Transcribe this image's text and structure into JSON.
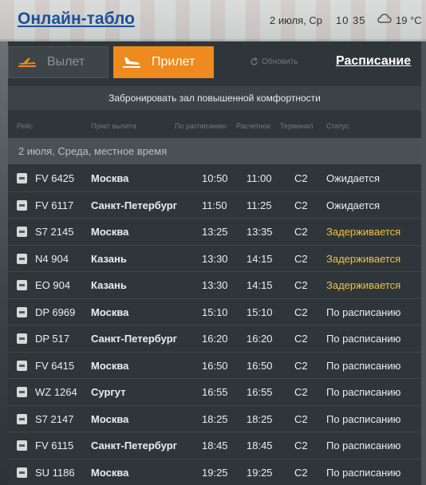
{
  "header": {
    "title": "Онлайн-табло",
    "date": "2 июля, Ср",
    "time": "10 35",
    "temperature": "19 °C",
    "weather_icon": "cloud-icon"
  },
  "tabs": {
    "departure": "Вылет",
    "arrival": "Прилет",
    "active": "arrival"
  },
  "refresh_label": "Обновить",
  "schedule_label": "Расписание",
  "banner": "Забронировать зал повышенной комфортности",
  "columns": {
    "flight": "Рейс",
    "origin": "Пункт вылета",
    "scheduled": "По расписанию",
    "estimated": "Расчетное",
    "terminal": "Терминал",
    "status": "Статус"
  },
  "date_row": "2 июля, Среда, местное время",
  "colors": {
    "accent": "#ee8a1e",
    "title": "#1e4f9a",
    "delayed": "#f0c040"
  },
  "flights": [
    {
      "flight": "FV 6425",
      "city": "Москва",
      "scheduled": "10:50",
      "estimated": "11:00",
      "terminal": "C2",
      "status": "Ожидается"
    },
    {
      "flight": "FV 6117",
      "city": "Санкт-Петербург",
      "scheduled": "11:50",
      "estimated": "11:25",
      "terminal": "C2",
      "status": "Ожидается"
    },
    {
      "flight": "S7 2145",
      "city": "Москва",
      "scheduled": "13:25",
      "estimated": "13:35",
      "terminal": "C2",
      "status": "Задерживается"
    },
    {
      "flight": "N4 904",
      "city": "Казань",
      "scheduled": "13:30",
      "estimated": "14:15",
      "terminal": "C2",
      "status": "Задерживается"
    },
    {
      "flight": "EO 904",
      "city": "Казань",
      "scheduled": "13:30",
      "estimated": "14:15",
      "terminal": "C2",
      "status": "Задерживается"
    },
    {
      "flight": "DP 6969",
      "city": "Москва",
      "scheduled": "15:10",
      "estimated": "15:10",
      "terminal": "C2",
      "status": "По расписанию"
    },
    {
      "flight": "DP 517",
      "city": "Санкт-Петербург",
      "scheduled": "16:20",
      "estimated": "16:20",
      "terminal": "C2",
      "status": "По расписанию"
    },
    {
      "flight": "FV 6415",
      "city": "Москва",
      "scheduled": "16:50",
      "estimated": "16:50",
      "terminal": "C2",
      "status": "По расписанию"
    },
    {
      "flight": "WZ 1264",
      "city": "Сургут",
      "scheduled": "16:55",
      "estimated": "16:55",
      "terminal": "C2",
      "status": "По расписанию"
    },
    {
      "flight": "S7 2147",
      "city": "Москва",
      "scheduled": "18:25",
      "estimated": "18:25",
      "terminal": "C2",
      "status": "По расписанию"
    },
    {
      "flight": "FV 6115",
      "city": "Санкт-Петербург",
      "scheduled": "18:45",
      "estimated": "18:45",
      "terminal": "C2",
      "status": "По расписанию"
    },
    {
      "flight": "SU 1186",
      "city": "Москва",
      "scheduled": "19:25",
      "estimated": "19:25",
      "terminal": "C2",
      "status": "По расписанию"
    }
  ]
}
